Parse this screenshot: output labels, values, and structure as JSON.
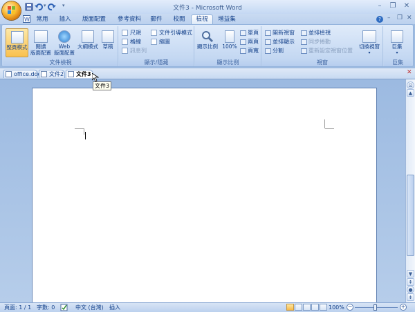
{
  "window": {
    "title": "文件3 - Microsoft Word"
  },
  "tabs": [
    "常用",
    "插入",
    "版面配置",
    "參考資料",
    "郵件",
    "校閱",
    "檢視",
    "增益集"
  ],
  "active_tab": "檢視",
  "ribbon": {
    "views": {
      "label": "文件檢視",
      "buttons": [
        "整頁模式",
        "閱讀\n版面配置",
        "Web\n版面配置",
        "大綱模式",
        "草稿"
      ]
    },
    "show_hide": {
      "label": "顯示/隱藏",
      "items": [
        "尺規",
        "格線",
        "訊息列",
        "文件引導模式",
        "縮圖"
      ]
    },
    "zoom": {
      "label": "顯示比例",
      "zoom_btn": "顯示比例",
      "pct_btn": "100%",
      "one_page": "單頁",
      "two_pages": "兩頁",
      "page_width": "頁寬"
    },
    "window": {
      "label": "視窗",
      "new_window": "開新視窗",
      "arrange_all": "並排顯示",
      "split": "分割",
      "side_by_side": "並排檢視",
      "sync_scroll": "同步捲動",
      "reset_pos": "重新設定視窗位置",
      "switch": "切換視窗"
    },
    "macros": {
      "label": "巨集",
      "btn": "巨集"
    }
  },
  "documents": [
    {
      "name": "office.doc",
      "active": false
    },
    {
      "name": "文件2",
      "active": false
    },
    {
      "name": "文件3",
      "active": true
    }
  ],
  "tooltip": "文件3",
  "status": {
    "page": "頁面: 1 / 1",
    "words": "字數: 0",
    "language": "中文 (台灣)",
    "mode": "插入",
    "zoom": "100%"
  },
  "colors": {
    "accent": "#f7b531",
    "ribbon": "#c7daf3",
    "workspace": "#9cbae1"
  }
}
